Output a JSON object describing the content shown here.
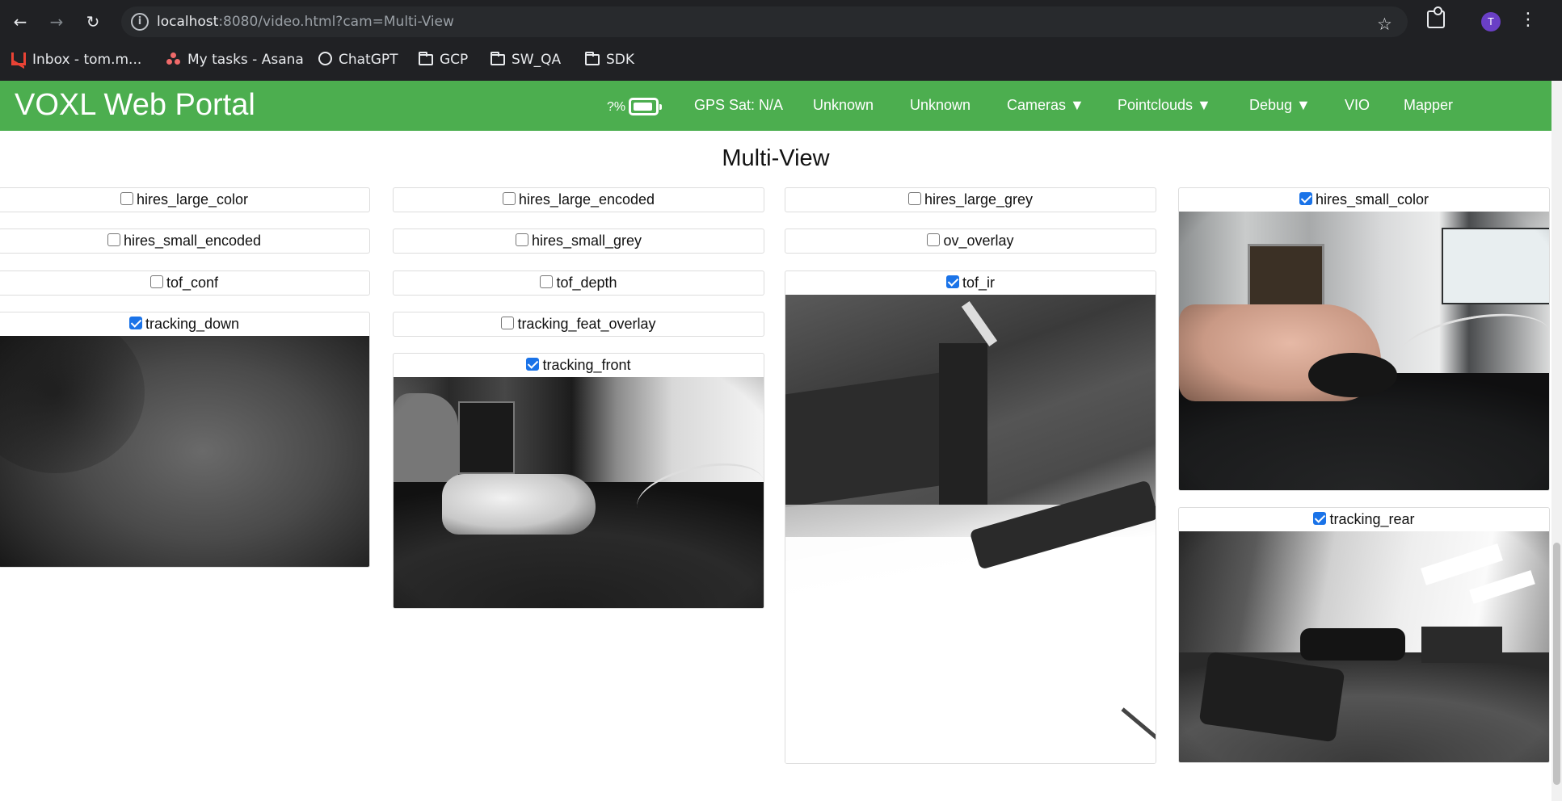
{
  "browser": {
    "url_host": "localhost",
    "url_rest": ":8080/video.html?cam=Multi-View",
    "profile_initial": "T",
    "bookmarks": [
      {
        "label": "Inbox - tom.m...",
        "icon": "gmail-icon"
      },
      {
        "label": "My tasks - Asana",
        "icon": "asana-icon"
      },
      {
        "label": "ChatGPT",
        "icon": "chatgpt-icon"
      },
      {
        "label": "GCP",
        "icon": "folder-icon"
      },
      {
        "label": "SW_QA",
        "icon": "folder-icon"
      },
      {
        "label": "SDK",
        "icon": "folder-icon"
      }
    ]
  },
  "portal": {
    "brand": "VOXL Web Portal",
    "accent_color": "#4cae4f",
    "battery": "?%",
    "nav": {
      "gps": "GPS Sat: N/A",
      "status1": "Unknown",
      "status2": "Unknown",
      "cameras": "Cameras ▼",
      "pointclouds": "Pointclouds ▼",
      "debug": "Debug ▼",
      "vio": "VIO",
      "mapper": "Mapper"
    },
    "title": "Multi-View"
  },
  "cameras": [
    {
      "name": "hires_large_color",
      "checked": false
    },
    {
      "name": "hires_large_encoded",
      "checked": false
    },
    {
      "name": "hires_large_grey",
      "checked": false
    },
    {
      "name": "hires_small_color",
      "checked": true
    },
    {
      "name": "hires_small_encoded",
      "checked": false
    },
    {
      "name": "hires_small_grey",
      "checked": false
    },
    {
      "name": "ov_overlay",
      "checked": false
    },
    {
      "name": "tof_conf",
      "checked": false
    },
    {
      "name": "tof_depth",
      "checked": false
    },
    {
      "name": "tof_ir",
      "checked": true
    },
    {
      "name": "tracking_down",
      "checked": true
    },
    {
      "name": "tracking_feat_overlay",
      "checked": false
    },
    {
      "name": "tracking_front",
      "checked": true
    },
    {
      "name": "tracking_rear",
      "checked": true
    }
  ]
}
